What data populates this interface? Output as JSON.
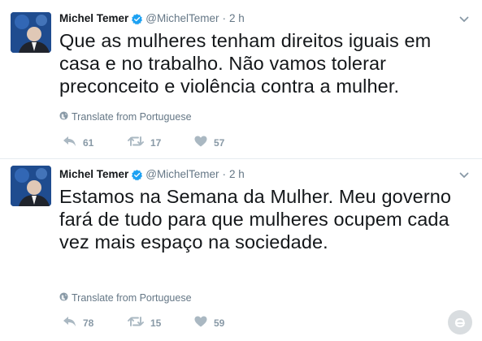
{
  "tweets": [
    {
      "author_name": "Michel Temer",
      "handle": "@MichelTemer",
      "separator": "·",
      "time": "2 h",
      "text": "Que as mulheres tenham direitos iguais em casa e no trabalho. Não vamos tolerar preconceito e violência contra a mulher.",
      "translate_label": "Translate from Portuguese",
      "replies": "61",
      "retweets": "17",
      "likes": "57"
    },
    {
      "author_name": "Michel Temer",
      "handle": "@MichelTemer",
      "separator": "·",
      "time": "2 h",
      "text": "Estamos na Semana da Mulher. Meu governo fará de tudo para que mulheres ocupem cada vez mais espaço na sociedade.",
      "translate_label": "Translate from Portuguese",
      "replies": "78",
      "retweets": "15",
      "likes": "59"
    }
  ],
  "icons": {
    "verified": "verified-badge-icon",
    "caret": "chevron-down-icon",
    "globe": "globe-icon",
    "reply": "reply-icon",
    "retweet": "retweet-icon",
    "like": "heart-icon",
    "watermark": "watermark-logo-icon"
  },
  "colors": {
    "text": "#14171a",
    "secondary": "#657786",
    "action": "#8899a6",
    "verified": "#1da1f2",
    "divider": "#e6ecf0"
  }
}
